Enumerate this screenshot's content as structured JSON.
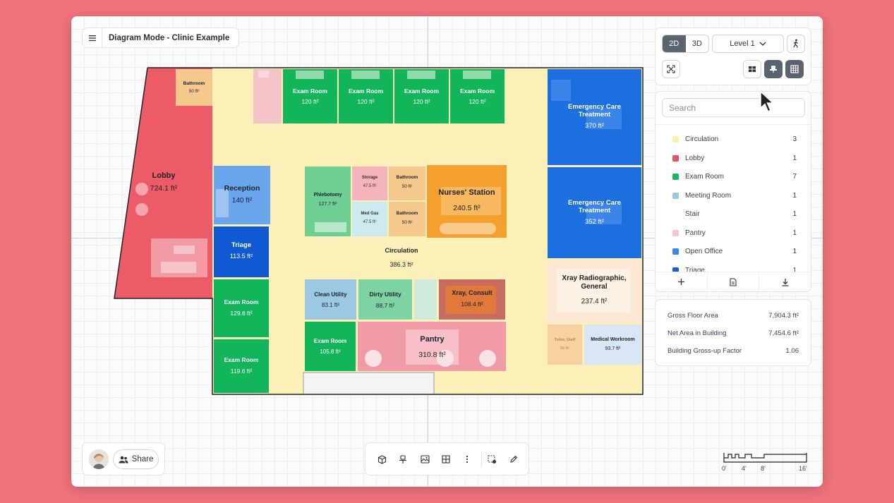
{
  "header": {
    "title": "Diagram Mode - Clinic Example"
  },
  "rooms": [
    {
      "name": "Bathroom",
      "area": "50 ft²"
    },
    {
      "name": "Exam Room",
      "area": "120 ft²"
    },
    {
      "name": "Exam Room",
      "area": "120 ft²"
    },
    {
      "name": "Exam Room",
      "area": "120 ft²"
    },
    {
      "name": "Exam Room",
      "area": "120 ft²"
    },
    {
      "name": "Emergency Care Treatment",
      "area": "370 ft²"
    },
    {
      "name": "Lobby",
      "area": "724.1 ft²"
    },
    {
      "name": "Reception",
      "area": "140 ft²"
    },
    {
      "name": "Phlebotomy",
      "area": "127.7 ft²"
    },
    {
      "name": "Storage",
      "area": "47.5 ft²"
    },
    {
      "name": "Bathroom",
      "area": "50 ft²"
    },
    {
      "name": "Med Gas",
      "area": "47.5 ft²"
    },
    {
      "name": "Bathroom",
      "area": "50 ft²"
    },
    {
      "name": "Nurses' Station",
      "area": "240.5 ft²"
    },
    {
      "name": "Emergency Care Treatment",
      "area": "352 ft²"
    },
    {
      "name": "Triage",
      "area": "113.5 ft²"
    },
    {
      "name": "Circulation",
      "area": "386.3 ft²"
    },
    {
      "name": "Xray Radiographic, General",
      "area": "237.4 ft²"
    },
    {
      "name": "Exam Room",
      "area": "129.6 ft²"
    },
    {
      "name": "Clean Utility",
      "area": "83.1 ft²"
    },
    {
      "name": "Dirty Utility",
      "area": "88.7 ft²"
    },
    {
      "name": "Xray, Consult",
      "area": "108.4 ft²"
    },
    {
      "name": "Toilet, Staff",
      "area": "56 ft²"
    },
    {
      "name": "Medical Workroom",
      "area": "93.7 ft²"
    },
    {
      "name": "Exam Room",
      "area": "105.8 ft²"
    },
    {
      "name": "Pantry",
      "area": "310.8 ft²"
    },
    {
      "name": "Exam Room",
      "area": "119.6 ft²"
    }
  ],
  "controls": {
    "mode_2d": "2D",
    "mode_3d": "3D",
    "level": "Level 1"
  },
  "search": {
    "placeholder": "Search"
  },
  "legend": [
    {
      "name": "Circulation",
      "count": "3",
      "color": "#fbefb2"
    },
    {
      "name": "Lobby",
      "count": "1",
      "color": "#e9535f"
    },
    {
      "name": "Exam Room",
      "count": "7",
      "color": "#18b85c"
    },
    {
      "name": "Meeting Room",
      "count": "1",
      "color": "#93cbdf"
    },
    {
      "name": "Stair",
      "count": "1",
      "color": "#ffffff"
    },
    {
      "name": "Pantry",
      "count": "1",
      "color": "#f8c3cb"
    },
    {
      "name": "Open Office",
      "count": "1",
      "color": "#3a86ea"
    },
    {
      "name": "Triage",
      "count": "1",
      "color": "#1560d8"
    }
  ],
  "stats": [
    {
      "label": "Gross Floor Area",
      "value": "7,904.3 ft²"
    },
    {
      "label": "Net Area in Building",
      "value": "7,454.6 ft²"
    },
    {
      "label": "Building Gross-up Factor",
      "value": "1.06"
    }
  ],
  "share": {
    "label": "Share"
  },
  "scale": {
    "labels": [
      "0'",
      "4'",
      "8'",
      "16'"
    ]
  }
}
